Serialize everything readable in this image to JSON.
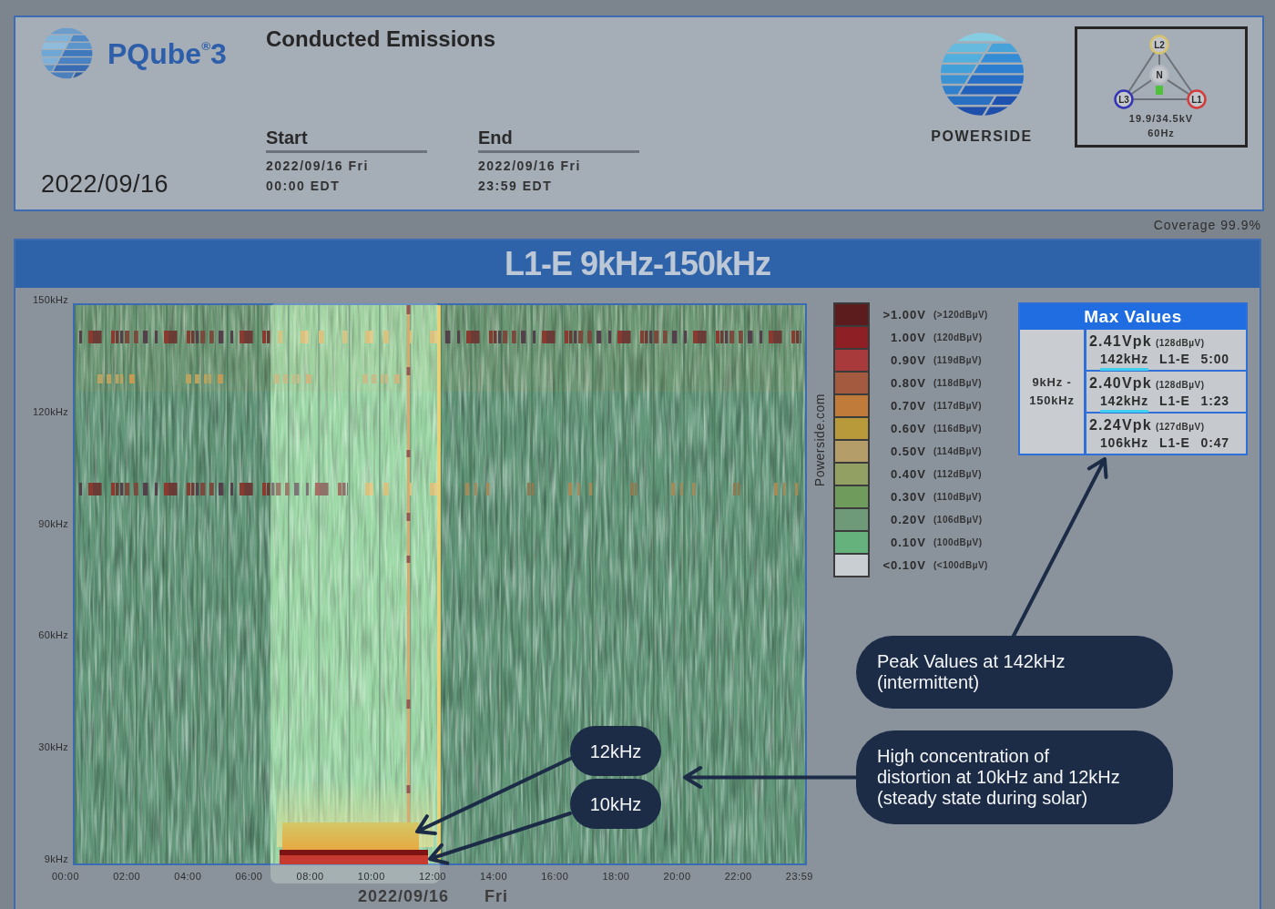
{
  "header": {
    "product": "PQube$^{®}$3",
    "title": "Conducted Emissions",
    "date": "2022/09/16",
    "start": {
      "label": "Start",
      "date": "2022/09/16 Fri",
      "time": "00:00 EDT"
    },
    "end": {
      "label": "End",
      "date": "2022/09/16 Fri",
      "time": "23:59 EDT"
    },
    "company": "POWERSIDE",
    "wiring": {
      "nodes": [
        {
          "label": "L2",
          "color": "#d6c36b"
        },
        {
          "label": "L3",
          "color": "#3434b4"
        },
        {
          "label": "L1",
          "color": "#d23c3c"
        },
        {
          "label": "N",
          "color": "#b8bcc2"
        }
      ],
      "voltage": "19.9/34.5kV",
      "frequency": "60Hz"
    }
  },
  "coverage": "Coverage 99.9%",
  "chart": {
    "title": "L1-E 9kHz-150kHz",
    "y_labels": [
      "150kHz",
      "120kHz",
      "90kHz",
      "60kHz",
      "30kHz",
      "9kHz"
    ],
    "x_labels": [
      "00:00",
      "02:00",
      "04:00",
      "06:00",
      "08:00",
      "10:00",
      "12:00",
      "14:00",
      "16:00",
      "18:00",
      "20:00",
      "22:00",
      "23:59"
    ],
    "date": "2022/09/16",
    "weekday": "Fri",
    "credit": "Powerside.com"
  },
  "legend": [
    {
      "voltage": ">1.00V",
      "dbuv": "(>120dBµV)",
      "color": "#5c1b1c"
    },
    {
      "voltage": "1.00V",
      "dbuv": "(120dBµV)",
      "color": "#8e1f24"
    },
    {
      "voltage": "0.90V",
      "dbuv": "(119dBµV)",
      "color": "#a83a3c"
    },
    {
      "voltage": "0.80V",
      "dbuv": "(118dBµV)",
      "color": "#a45a3e"
    },
    {
      "voltage": "0.70V",
      "dbuv": "(117dBµV)",
      "color": "#c07a3a"
    },
    {
      "voltage": "0.60V",
      "dbuv": "(116dBµV)",
      "color": "#b99a3a"
    },
    {
      "voltage": "0.50V",
      "dbuv": "(114dBµV)",
      "color": "#b59d6a"
    },
    {
      "voltage": "0.40V",
      "dbuv": "(112dBµV)",
      "color": "#93a064"
    },
    {
      "voltage": "0.30V",
      "dbuv": "(110dBµV)",
      "color": "#6f9c5c"
    },
    {
      "voltage": "0.20V",
      "dbuv": "(106dBµV)",
      "color": "#6e9a7a"
    },
    {
      "voltage": "0.10V",
      "dbuv": "(100dBµV)",
      "color": "#66b27d"
    },
    {
      "voltage": "<0.10V",
      "dbuv": "(<100dBµV)",
      "color": "#c9ced3"
    }
  ],
  "max_values": {
    "title": "Max Values",
    "range": "9kHz - 150kHz",
    "rows": [
      {
        "peak": "2.41Vpk",
        "dbuv": "(128dBµV)",
        "frequency": "142kHz",
        "channel": "L1-E",
        "time": "5:00",
        "highlighted": true
      },
      {
        "peak": "2.40Vpk",
        "dbuv": "(128dBµV)",
        "frequency": "142kHz",
        "channel": "L1-E",
        "time": "1:23",
        "highlighted": true
      },
      {
        "peak": "2.24Vpk",
        "dbuv": "(127dBµV)",
        "frequency": "106kHz",
        "channel": "L1-E",
        "time": "0:47",
        "highlighted": false
      }
    ]
  },
  "annotations": [
    {
      "kind": "tag",
      "text": "12kHz"
    },
    {
      "kind": "tag",
      "text": "10kHz"
    },
    {
      "kind": "note",
      "text": "Peak Values at 142kHz\n(intermittent)"
    },
    {
      "kind": "note",
      "text": "High concentration of\ndistortion at 10kHz and 12kHz\n(steady state during solar)"
    }
  ]
}
